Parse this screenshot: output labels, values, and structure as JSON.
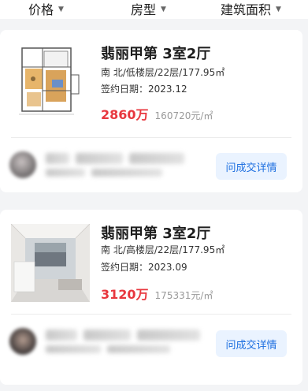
{
  "filters": [
    {
      "label": "价格",
      "icon": "chevron-down-icon"
    },
    {
      "label": "房型",
      "icon": "chevron-down-icon"
    },
    {
      "label": "建筑面积",
      "icon": "chevron-down-icon"
    }
  ],
  "listings": [
    {
      "title": "翡丽甲第 3室2厅",
      "info": "南 北/低楼层/22层/177.95㎡",
      "date": "签约日期：2023.12",
      "price": "2860万",
      "unit_price": "160720元/㎡",
      "action": "问成交详情",
      "thumb": "floor-plan-image"
    },
    {
      "title": "翡丽甲第 3室2厅",
      "info": "南 北/高楼层/22层/177.95㎡",
      "date": "签约日期：2023.09",
      "price": "3120万",
      "unit_price": "175331元/㎡",
      "action": "问成交详情",
      "thumb": "room-photo-image"
    }
  ],
  "colors": {
    "price": "#e8373e",
    "action_text": "#1d6fe0",
    "action_bg": "#eaf3ff",
    "background": "#f3f4f6"
  }
}
